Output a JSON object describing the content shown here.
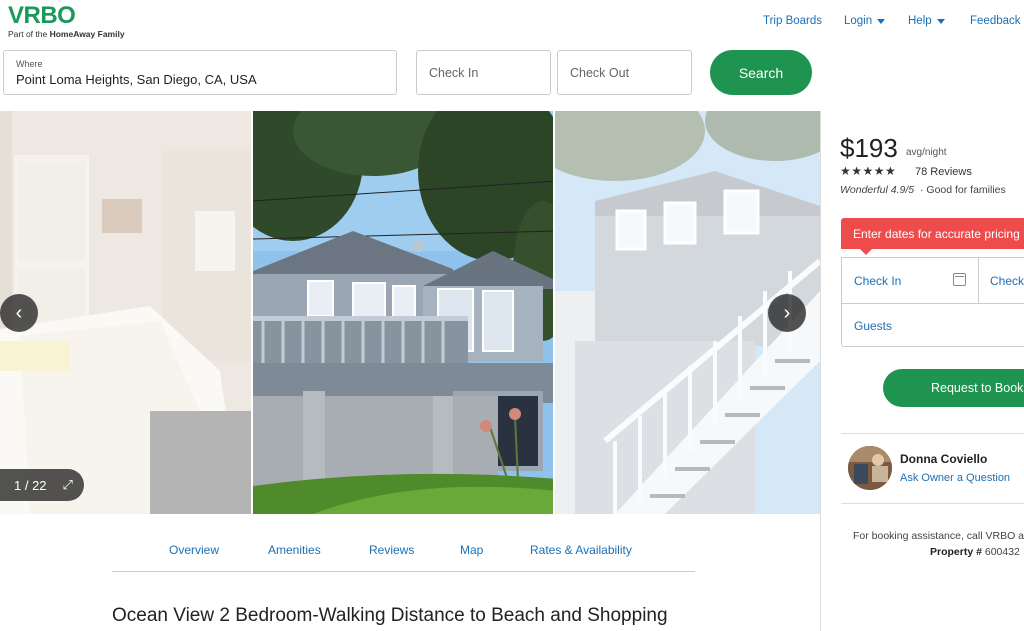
{
  "header": {
    "logo": "VRBO",
    "logo_sub_prefix": "Part of the ",
    "logo_sub_brand": "HomeAway Family",
    "nav": {
      "trip_boards": "Trip Boards",
      "login": "Login",
      "help": "Help",
      "feedback": "Feedback"
    }
  },
  "search": {
    "where_label": "Where",
    "where_value": "Point Loma Heights, San Diego, CA, USA",
    "check_in_placeholder": "Check In",
    "check_out_placeholder": "Check Out",
    "search_label": "Search"
  },
  "gallery": {
    "prev_icon": "‹",
    "next_icon": "›",
    "counter": "1 / 22",
    "expand_icon": "⤢"
  },
  "tabs": [
    "Overview",
    "Amenities",
    "Reviews",
    "Map",
    "Rates & Availability"
  ],
  "listing": {
    "title": "Ocean View 2 Bedroom-Walking Distance to Beach and Shopping"
  },
  "sidebar": {
    "price": "$193",
    "price_unit": "avg/night",
    "stars": "★★★★★",
    "reviews": "78 Reviews",
    "rating_text": "Wonderful 4.9/5",
    "rating_extra": "· Good for families",
    "banner": "Enter dates for accurate pricing",
    "check_in": "Check In",
    "check_out": "Check",
    "guests": "Guests",
    "request_label": "Request to Book",
    "owner_name": "Donna Coviello",
    "ask_owner": "Ask Owner a Question",
    "assist_text": "For booking assistance, call VRBO at",
    "property_label": "Property #",
    "property_number": "600432"
  },
  "colors": {
    "brand_green": "#1f9451",
    "link_blue": "#1c6fb5",
    "alert_red": "#ee4c4c"
  }
}
